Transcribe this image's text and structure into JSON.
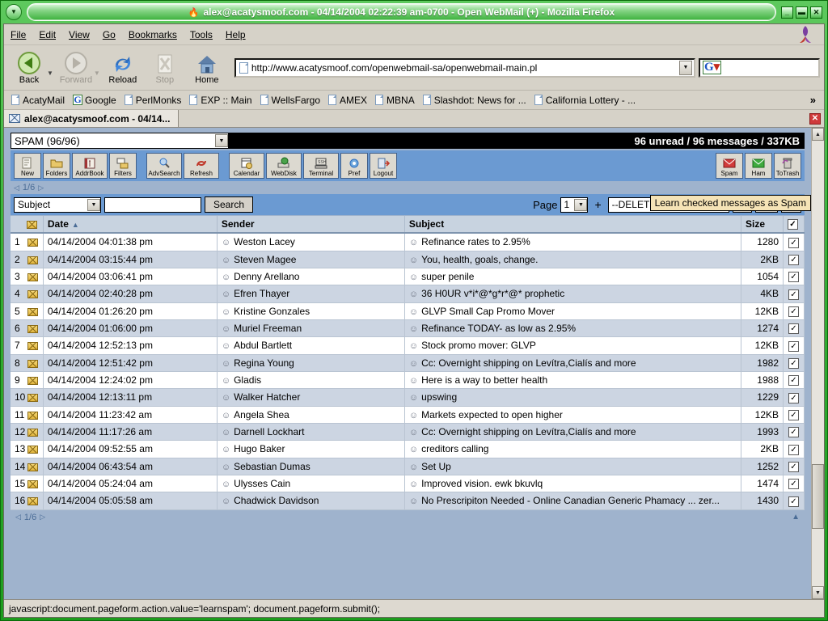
{
  "window": {
    "title": "alex@acatysmoof.com - 04/14/2004 02:22:39 am-0700 - Open WebMail (+) - Mozilla Firefox",
    "minimize": "_",
    "maximize": "▬",
    "close": "✕",
    "menu_glyph": "▼"
  },
  "menubar": {
    "items": [
      "File",
      "Edit",
      "View",
      "Go",
      "Bookmarks",
      "Tools",
      "Help"
    ]
  },
  "navbar": {
    "back": "Back",
    "forward": "Forward",
    "reload": "Reload",
    "stop": "Stop",
    "home": "Home",
    "url": "http://www.acatysmoof.com/openwebmail-sa/openwebmail-main.pl",
    "search_placeholder": "",
    "search_value": ""
  },
  "bookmarks": {
    "items": [
      {
        "label": "AcatyMail",
        "icon": "page-icon"
      },
      {
        "label": "Google",
        "icon": "google-icon"
      },
      {
        "label": "PerlMonks",
        "icon": "page-icon"
      },
      {
        "label": "EXP :: Main",
        "icon": "page-icon"
      },
      {
        "label": "WellsFargo",
        "icon": "page-icon"
      },
      {
        "label": "AMEX",
        "icon": "page-icon"
      },
      {
        "label": "MBNA",
        "icon": "page-icon"
      },
      {
        "label": "Slashdot: News for ...",
        "icon": "page-icon"
      },
      {
        "label": "California Lottery - ...",
        "icon": "page-icon"
      }
    ],
    "overflow": "»"
  },
  "tab": {
    "label": "alex@acatysmoof.com - 04/14...",
    "close": "✕"
  },
  "webmail": {
    "folder_selected": "SPAM (96/96)",
    "status_banner": "96 unread / 96 messages / 337KB",
    "toolbar_left": [
      {
        "label": "New",
        "icon": "new-message-icon",
        "glyph": "📄"
      },
      {
        "label": "Folders",
        "icon": "folders-icon",
        "glyph": "📂"
      },
      {
        "label": "AddrBook",
        "icon": "address-book-icon",
        "glyph": "📕"
      },
      {
        "label": "Filters",
        "icon": "filters-icon",
        "glyph": "✉"
      }
    ],
    "toolbar_mid": [
      {
        "label": "AdvSearch",
        "icon": "advanced-search-icon",
        "glyph": "🔍"
      },
      {
        "label": "Refresh",
        "icon": "refresh-icon",
        "glyph": "↻"
      }
    ],
    "toolbar_right": [
      {
        "label": "Calendar",
        "icon": "calendar-icon",
        "glyph": "📅"
      },
      {
        "label": "WebDisk",
        "icon": "webdisk-icon",
        "glyph": "💾"
      },
      {
        "label": "Terminal",
        "icon": "terminal-icon",
        "glyph": "⌨"
      },
      {
        "label": "Pref",
        "icon": "preferences-icon",
        "glyph": "⚙"
      },
      {
        "label": "Logout",
        "icon": "logout-icon",
        "glyph": "↪"
      }
    ],
    "toolbar_far_right": [
      {
        "label": "Spam",
        "icon": "spam-icon",
        "glyph": "✉"
      },
      {
        "label": "Ham",
        "icon": "ham-icon",
        "glyph": "✉"
      },
      {
        "label": "ToTrash",
        "icon": "trash-icon",
        "glyph": "🗑"
      }
    ],
    "page_indicator": "1/6",
    "prev_arrow": "◁",
    "next_arrow": "▷",
    "search_field": "Subject",
    "search_value": "",
    "search_button": "Search",
    "page_label": "Page",
    "page_value": "1",
    "plus": "+",
    "action_select": "--DELETE--",
    "tooltip": "Learn checked messages as Spam",
    "up_arrow": "▲",
    "columns": [
      "",
      "",
      "Date",
      "Sender",
      "Subject",
      "Size",
      ""
    ],
    "sort_column": "Date",
    "sort_direction": "▲",
    "header_checkbox": "✓",
    "messages": [
      {
        "num": "1",
        "date": "04/14/2004 04:01:38 pm",
        "sender": "Weston Lacey",
        "subject": "Refinance rates to 2.95%",
        "size": "1280",
        "checked": true
      },
      {
        "num": "2",
        "date": "04/14/2004 03:15:44 pm",
        "sender": "Steven Magee",
        "subject": "You, health, goals, change.",
        "size": "2KB",
        "checked": true
      },
      {
        "num": "3",
        "date": "04/14/2004 03:06:41 pm",
        "sender": "Denny Arellano",
        "subject": "super penile",
        "size": "1054",
        "checked": true
      },
      {
        "num": "4",
        "date": "04/14/2004 02:40:28 pm",
        "sender": "Efren Thayer",
        "subject": "36 H0UR v*i*@*g*r*@* prophetic",
        "size": "4KB",
        "checked": true
      },
      {
        "num": "5",
        "date": "04/14/2004 01:26:20 pm",
        "sender": "Kristine Gonzales",
        "subject": "GLVP Small Cap Promo Mover",
        "size": "12KB",
        "checked": true
      },
      {
        "num": "6",
        "date": "04/14/2004 01:06:00 pm",
        "sender": "Muriel Freeman",
        "subject": "Refinance TODAY- as low as 2.95%",
        "size": "1274",
        "checked": true
      },
      {
        "num": "7",
        "date": "04/14/2004 12:52:13 pm",
        "sender": "Abdul Bartlett",
        "subject": "Stock promo mover: GLVP",
        "size": "12KB",
        "checked": true
      },
      {
        "num": "8",
        "date": "04/14/2004 12:51:42 pm",
        "sender": "Regina Young",
        "subject": "Cc: Overnight shipping on Levítra,Cialís and more",
        "size": "1982",
        "checked": true
      },
      {
        "num": "9",
        "date": "04/14/2004 12:24:02 pm",
        "sender": "Gladis",
        "subject": "Here is a way to better health",
        "size": "1988",
        "checked": true
      },
      {
        "num": "10",
        "date": "04/14/2004 12:13:11 pm",
        "sender": "Walker Hatcher",
        "subject": "upswing",
        "size": "1229",
        "checked": true
      },
      {
        "num": "11",
        "date": "04/14/2004 11:23:42 am",
        "sender": "Angela Shea",
        "subject": "Markets expected to open higher",
        "size": "12KB",
        "checked": true
      },
      {
        "num": "12",
        "date": "04/14/2004 11:17:26 am",
        "sender": "Darnell Lockhart",
        "subject": "Cc: Overnight shipping on Levítra,Cialís and more",
        "size": "1993",
        "checked": true
      },
      {
        "num": "13",
        "date": "04/14/2004 09:52:55 am",
        "sender": "Hugo Baker",
        "subject": "creditors calling",
        "size": "2KB",
        "checked": true
      },
      {
        "num": "14",
        "date": "04/14/2004 06:43:54 am",
        "sender": "Sebastian Dumas",
        "subject": "Set Up",
        "size": "1252",
        "checked": true
      },
      {
        "num": "15",
        "date": "04/14/2004 05:24:04 am",
        "sender": "Ulysses Cain",
        "subject": "Improved vision. ewk bkuvlq",
        "size": "1474",
        "checked": true
      },
      {
        "num": "16",
        "date": "04/14/2004 05:05:58 am",
        "sender": "Chadwick Davidson",
        "subject": "No Prescripiton Needed - Online Canadian Generic Phamacy ... zer...",
        "size": "1430",
        "checked": true
      }
    ]
  },
  "statusbar": {
    "text": "javascript:document.pageform.action.value='learnspam'; document.pageform.submit();"
  },
  "colors": {
    "frame_green": "#35ad35",
    "page_blue": "#9fb3cd",
    "toolbar_blue": "#6b9ad2",
    "row_even": "#ccd5e2",
    "header_blue": "#c8d3e0",
    "tooltip_bg": "#f5e3b6"
  }
}
